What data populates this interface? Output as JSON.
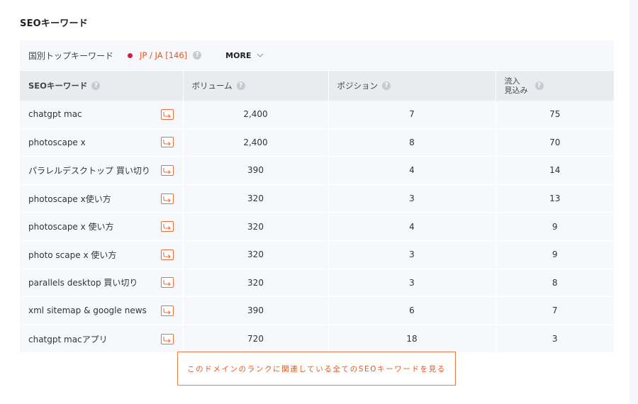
{
  "section_title": "SEOキーワード",
  "filter": {
    "label": "国別トップキーワード",
    "country": "JP / JA  [146]",
    "more_label": "MORE"
  },
  "columns": {
    "keyword": "SEOキーワード",
    "volume": "ボリューム",
    "position": "ポジション",
    "traffic_line1": "流入",
    "traffic_line2": "見込み"
  },
  "rows": [
    {
      "keyword": "chatgpt mac",
      "volume": "2,400",
      "position": "7",
      "traffic": "75"
    },
    {
      "keyword": "photoscape x",
      "volume": "2,400",
      "position": "8",
      "traffic": "70"
    },
    {
      "keyword": "パラレルデスクトップ 買い切り",
      "volume": "390",
      "position": "4",
      "traffic": "14"
    },
    {
      "keyword": "photoscape x使い方",
      "volume": "320",
      "position": "3",
      "traffic": "13"
    },
    {
      "keyword": "photoscape x 使い方",
      "volume": "320",
      "position": "4",
      "traffic": "9"
    },
    {
      "keyword": "photo scape x 使い方",
      "volume": "320",
      "position": "3",
      "traffic": "9"
    },
    {
      "keyword": "parallels desktop 買い切り",
      "volume": "320",
      "position": "3",
      "traffic": "8"
    },
    {
      "keyword": "xml sitemap & google news",
      "volume": "390",
      "position": "6",
      "traffic": "7"
    },
    {
      "keyword": "chatgpt macアプリ",
      "volume": "720",
      "position": "18",
      "traffic": "3"
    }
  ],
  "cta_label": "このドメインのランクに関連している全てのSEOキーワードを見る",
  "icons": {
    "help": "help-icon",
    "external": "external-link-icon",
    "more": "chevron-down-icon"
  },
  "colors": {
    "accent": "#e8561f",
    "country_dot": "#d21e3c",
    "row_bg": "#f6f8fb",
    "header_bg": "#e9ecef"
  }
}
